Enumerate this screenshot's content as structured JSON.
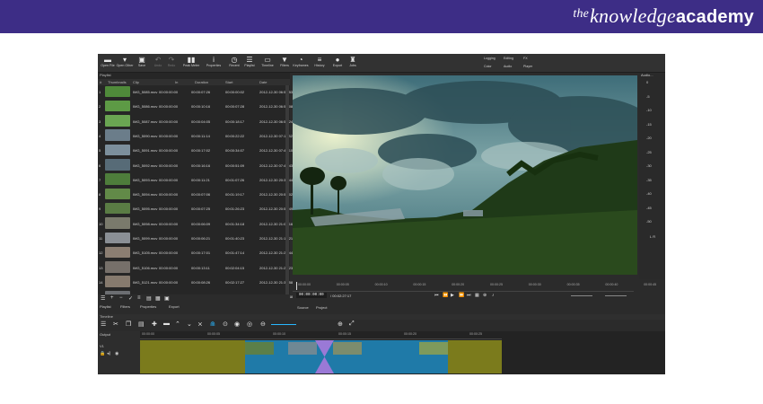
{
  "brand": {
    "part1": "the",
    "part2": "knowledge",
    "part3": "academy"
  },
  "toolbar": {
    "items": [
      {
        "label": "Open File",
        "icon": "folder-icon",
        "glyph": "▬"
      },
      {
        "label": "Open Other",
        "icon": "open-other-icon",
        "glyph": "▾"
      },
      {
        "label": "Save",
        "icon": "save-icon",
        "glyph": "▣"
      },
      {
        "label": "Undo",
        "icon": "undo-icon",
        "glyph": "↶"
      },
      {
        "label": "Redo",
        "icon": "redo-icon",
        "glyph": "↷"
      },
      {
        "label": "Peak Meter",
        "icon": "peak-meter-icon",
        "glyph": "▮▮"
      },
      {
        "label": "Properties",
        "icon": "properties-icon",
        "glyph": "i"
      },
      {
        "label": "Recent",
        "icon": "recent-icon",
        "glyph": "◷"
      },
      {
        "label": "Playlist",
        "icon": "playlist-icon",
        "glyph": "☰"
      },
      {
        "label": "Timeline",
        "icon": "timeline-icon",
        "glyph": "▭"
      },
      {
        "label": "Filters",
        "icon": "filter-icon",
        "glyph": "▼"
      },
      {
        "label": "Keyframes",
        "icon": "keyframes-icon",
        "glyph": "◔"
      },
      {
        "label": "History",
        "icon": "history-icon",
        "glyph": "≡"
      },
      {
        "label": "Export",
        "icon": "export-icon",
        "glyph": "●"
      },
      {
        "label": "Jobs",
        "icon": "jobs-icon",
        "glyph": "♜"
      }
    ],
    "right_top": [
      "Logging",
      "Editing",
      "FX"
    ],
    "right_bottom": [
      "Color",
      "Audio",
      "Player"
    ]
  },
  "playlist": {
    "title": "Playlist",
    "columns": [
      "#",
      "Thumbnails",
      "Clip",
      "In",
      "Duration",
      "Start",
      "Date"
    ],
    "rows": [
      {
        "n": "1",
        "clip": "IMG_5085.mov",
        "in": "00:00:00:00",
        "duration": "00:00:07:26",
        "start": "00:00:00:02",
        "date": "2012-12-30 06:56:53",
        "color": "#4f8a3a"
      },
      {
        "n": "2",
        "clip": "IMG_5086.mov",
        "in": "00:00:00:00",
        "duration": "00:00:10:16",
        "start": "00:00:07:28",
        "date": "2012-12-30 06:57:08",
        "color": "#5d9a45"
      },
      {
        "n": "3",
        "clip": "IMG_5087.mov",
        "in": "00:00:00:00",
        "duration": "00:00:04:05",
        "start": "00:00:18:17",
        "date": "2012-12-30 06:57:24",
        "color": "#6aa552"
      },
      {
        "n": "4",
        "clip": "IMG_5090.mov",
        "in": "00:00:00:00",
        "duration": "00:00:11:14",
        "start": "00:00:22:22",
        "date": "2012-12-30 07:11:32",
        "color": "#6b7d8a"
      },
      {
        "n": "5",
        "clip": "IMG_5091.mov",
        "in": "00:00:00:00",
        "duration": "00:00:17:02",
        "start": "00:00:34:07",
        "date": "2012-12-30 07:45:10",
        "color": "#7c8f9c"
      },
      {
        "n": "6",
        "clip": "IMG_5092.mov",
        "in": "00:00:00:00",
        "duration": "00:00:16:16",
        "start": "00:00:51:09",
        "date": "2012-12-30 07:45:43",
        "color": "#576b77"
      },
      {
        "n": "7",
        "clip": "IMG_5093.mov",
        "in": "00:00:00:00",
        "duration": "00:00:11:21",
        "start": "00:01:07:26",
        "date": "2012-12-30 20:36:44",
        "color": "#4e7d3b"
      },
      {
        "n": "8",
        "clip": "IMG_5094.mov",
        "in": "00:00:00:00",
        "duration": "00:00:07:06",
        "start": "00:01:19:17",
        "date": "2012-12-30 20:59:02",
        "color": "#628a48"
      },
      {
        "n": "9",
        "clip": "IMG_5095.mov",
        "in": "00:00:00:00",
        "duration": "00:00:07:25",
        "start": "00:01:26:23",
        "date": "2012-12-30 20:59:49",
        "color": "#5a7c44"
      },
      {
        "n": "10",
        "clip": "IMG_5098.mov",
        "in": "00:00:00:00",
        "duration": "00:00:06:09",
        "start": "00:01:34:18",
        "date": "2012-12-30 21:01:16",
        "color": "#7a7a6c"
      },
      {
        "n": "11",
        "clip": "IMG_5099.mov",
        "in": "00:00:00:00",
        "duration": "00:00:06:21",
        "start": "00:01:40:23",
        "date": "2012-12-30 21:10:21",
        "color": "#8a8f95"
      },
      {
        "n": "12",
        "clip": "IMG_5105.mov",
        "in": "00:00:00:00",
        "duration": "00:00:17:01",
        "start": "00:01:47:14",
        "date": "2012-12-30 21:22:44",
        "color": "#8b7e72"
      },
      {
        "n": "13",
        "clip": "IMG_5106.mov",
        "in": "00:00:00:00",
        "duration": "00:00:13:11",
        "start": "00:02:04:15",
        "date": "2012-12-30 21:23:23",
        "color": "#76706a"
      },
      {
        "n": "14",
        "clip": "IMG_5121.mov",
        "in": "00:00:00:00",
        "duration": "00:00:08:26",
        "start": "00:02:17:27",
        "date": "2012-12-30 21:33:58",
        "color": "#867a6e"
      },
      {
        "n": "15",
        "clip": "IMG_5126.mov",
        "in": "00:00:00:00",
        "duration": "00:00:07:13",
        "start": "00:02:24:23",
        "date": "2012-12-30 21:33:48",
        "color": "#6c6e72"
      }
    ],
    "tabs": [
      "Playlist",
      "Filters",
      "Properties",
      "Export"
    ]
  },
  "meter": {
    "title": "Audio...",
    "levels": [
      "0",
      "-5",
      "-10",
      "-15",
      "-20",
      "-25",
      "-30",
      "-35",
      "-40",
      "-45",
      "-50"
    ],
    "channels": "L R"
  },
  "player": {
    "ruler": [
      "00:00:00",
      "00:00:05",
      "00:00:10",
      "00:00:15",
      "00:00:20",
      "00:00:25",
      "00:00:30",
      "00:00:35",
      "00:00:40",
      "00:00:45"
    ],
    "timecode": "00:00:00:00",
    "duration": "/ 00:02:27:17",
    "source_tab": "Source",
    "project_tab": "Project"
  },
  "timeline": {
    "title": "Timeline",
    "track_label": "Output",
    "track_name": "V1",
    "ruler": [
      "00:00:00",
      "00:00:05",
      "00:00:10",
      "00:00:15",
      "00:00:20",
      "00:00:25"
    ]
  }
}
